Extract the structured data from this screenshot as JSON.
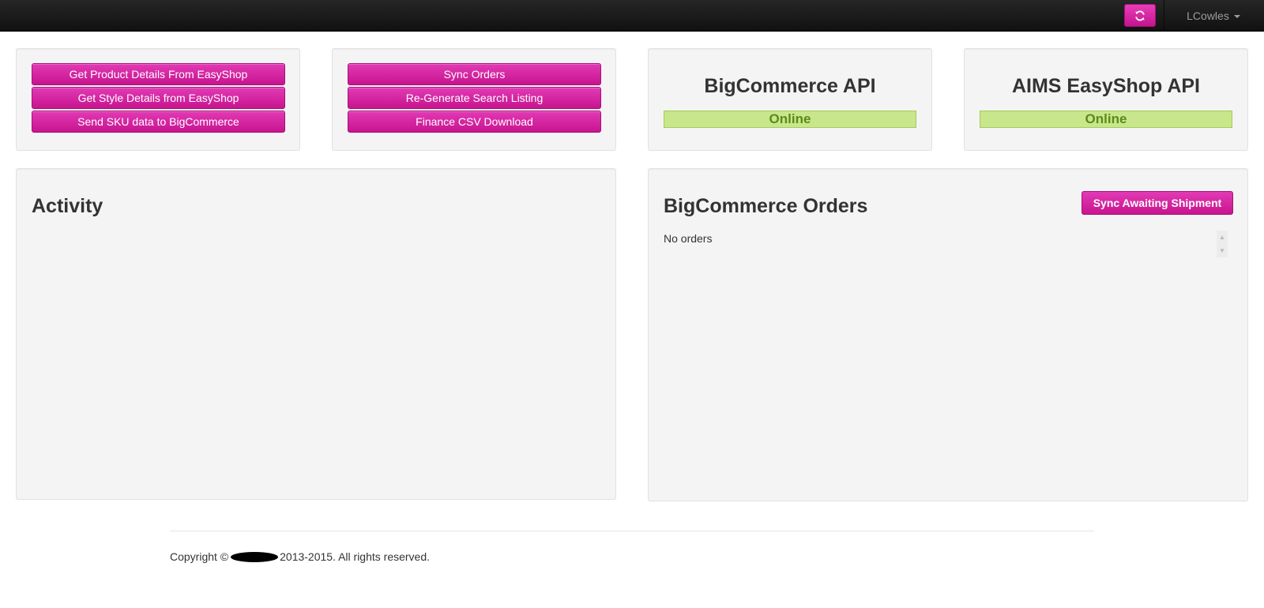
{
  "navbar": {
    "refresh_icon": "refresh-icon",
    "user_name": "LCowles"
  },
  "easyshop_actions": {
    "buttons": [
      "Get Product Details From EasyShop",
      "Get Style Details from EasyShop",
      "Send SKU data to BigCommerce"
    ]
  },
  "order_actions": {
    "buttons": [
      "Sync Orders",
      "Re-Generate Search Listing",
      "Finance CSV Download"
    ]
  },
  "api_status": [
    {
      "title": "BigCommerce API",
      "status": "Online"
    },
    {
      "title": "AIMS EasyShop API",
      "status": "Online"
    }
  ],
  "activity": {
    "title": "Activity"
  },
  "orders": {
    "title": "BigCommerce Orders",
    "sync_button": "Sync Awaiting Shipment",
    "empty_text": "No orders"
  },
  "footer": {
    "prefix": "Copyright ©",
    "suffix": "2013-2015. All rights reserved."
  },
  "colors": {
    "accent": "#d0208f",
    "status_online_bg": "#c8e68c",
    "status_online_text": "#5c8a1a",
    "navbar": "#1b1b1b"
  }
}
